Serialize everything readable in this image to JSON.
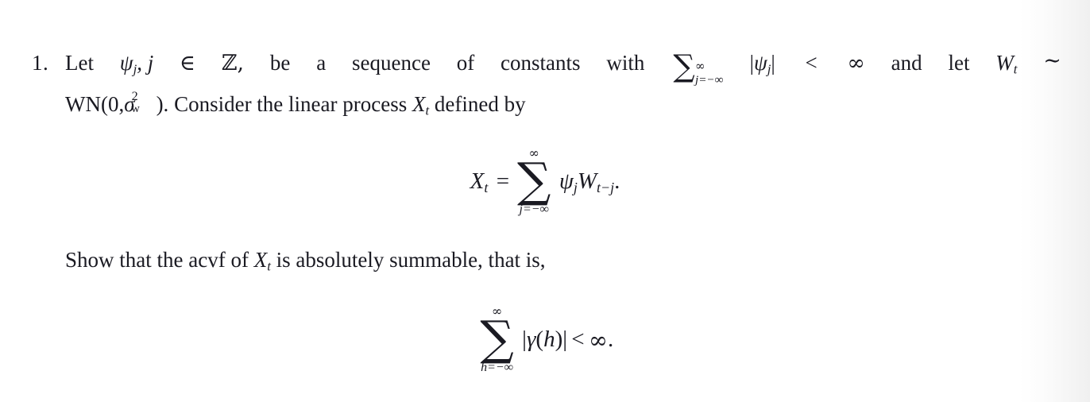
{
  "document": {
    "type": "math-problem-statement",
    "background_color": "#ffffff",
    "text_color": "#1a1a22",
    "problem_number": "1.",
    "line1": {
      "words": [
        "Let",
        "ψ",
        "j",
        ",",
        "j",
        "∈",
        "ℤ,",
        "be",
        "a",
        "sequence",
        "of",
        "constants",
        "with"
      ],
      "text_before_sum": "Let ψ_j, j ∈ ℤ, be a sequence of constants with",
      "w_let": "Let",
      "w_be": "be",
      "w_a": "a",
      "w_sequence": "sequence",
      "w_of": "of",
      "w_constants": "constants",
      "w_with": "with",
      "psi": "ψ",
      "psi_sub": "j",
      "comma_j": ", j",
      "in_symbol": "∈",
      "set_Z": "ℤ,",
      "sum_upper": "∞",
      "sum_lower": "j=−∞",
      "sum_symbol": "∑",
      "abs_open": "|",
      "abs_psi": "ψ",
      "abs_psi_sub": "j",
      "abs_close": "|",
      "less_than": "<",
      "infinity": "∞",
      "w_and": "and",
      "w_let2": "let",
      "W": "W",
      "W_sub": "t",
      "tilde": "∼"
    },
    "line2": {
      "wn": "WN(0,",
      "sigma": "σ",
      "sigma_sup": "2",
      "sigma_sub": "w",
      "close_paren": ").",
      "text": "Consider the linear process",
      "X": "X",
      "X_sub": "t",
      "tail": "defined by",
      "full_text": "WN(0, σ²_w). Consider the linear process X_t defined by"
    },
    "equation1": {
      "lhs_var": "X",
      "lhs_sub": "t",
      "equals": "=",
      "sum_symbol": "∑",
      "upper_limit": "∞",
      "lower_limit": "j=−∞",
      "psi": "ψ",
      "psi_sub": "j",
      "W": "W",
      "W_sub": "t−j",
      "period": ".",
      "latex": "X_t = \\sum_{j=-\\infty}^{\\infty} \\psi_j W_{t-j}."
    },
    "midline": {
      "before": "Show that the acvf of",
      "X": "X",
      "X_sub": "t",
      "after": "is absolutely summable, that is,",
      "full_text": "Show that the acvf of X_t is absolutely summable, that is,"
    },
    "equation2": {
      "sum_symbol": "∑",
      "upper_limit": "∞",
      "lower_limit": "h=−∞",
      "abs_open": "|",
      "gamma": "γ",
      "arg_open": "(",
      "arg": "h",
      "arg_close": ")",
      "abs_close": "|",
      "less_than": "<",
      "infinity": "∞",
      "period": ".",
      "latex": "\\sum_{h=-\\infty}^{\\infty} |\\gamma(h)| < \\infty."
    }
  }
}
